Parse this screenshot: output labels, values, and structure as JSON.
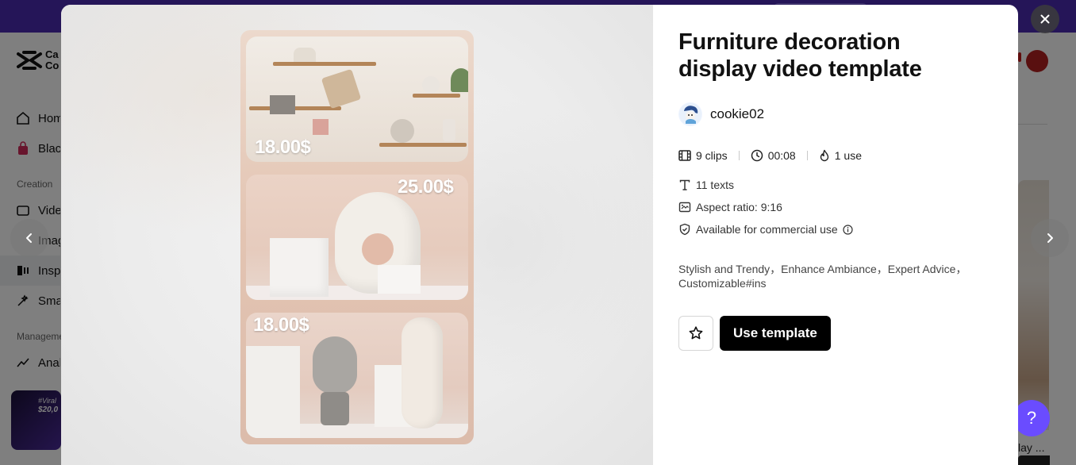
{
  "background": {
    "logo_text": "Ca Co",
    "nav": [
      {
        "label": "Home",
        "icon": "home-icon"
      },
      {
        "label": "Black",
        "icon": "bag-icon"
      },
      {
        "label": "Video",
        "icon": "video-icon"
      },
      {
        "label": "Image",
        "icon": "image-icon"
      },
      {
        "label": "Inspiration",
        "icon": "inspiration-icon"
      },
      {
        "label": "Smart",
        "icon": "smart-icon"
      },
      {
        "label": "Analytics",
        "icon": "analytics-icon"
      }
    ],
    "sections": {
      "creation": "Creation",
      "management": "Manageme"
    },
    "promo": {
      "line1": "#Viral",
      "line2": "$20,0"
    },
    "thumb_caption": "lay ..."
  },
  "modal": {
    "title": "Furniture decoration display video template",
    "author": {
      "name": "cookie02",
      "avatar_icon": "author-avatar-icon"
    },
    "stats": {
      "clips": "9 clips",
      "duration": "00:08",
      "uses": "1 use"
    },
    "meta": {
      "texts": "11 texts",
      "aspect_ratio": "Aspect ratio: 9:16",
      "commercial": "Available for commercial use"
    },
    "tags": "Stylish and Trendy，Enhance Ambiance，Expert Advice，Customizable#ins",
    "buttons": {
      "favorite_icon": "star-icon",
      "use_template": "Use template"
    },
    "preview": {
      "prices": [
        "18.00$",
        "25.00$",
        "18.00$"
      ]
    }
  },
  "controls": {
    "close_icon": "close-icon",
    "prev_icon": "chevron-left-icon",
    "next_icon": "chevron-right-icon"
  },
  "colors": {
    "topbar": "#4b2bb0",
    "use_button_bg": "#000000",
    "help_button": "#6a4cff"
  }
}
